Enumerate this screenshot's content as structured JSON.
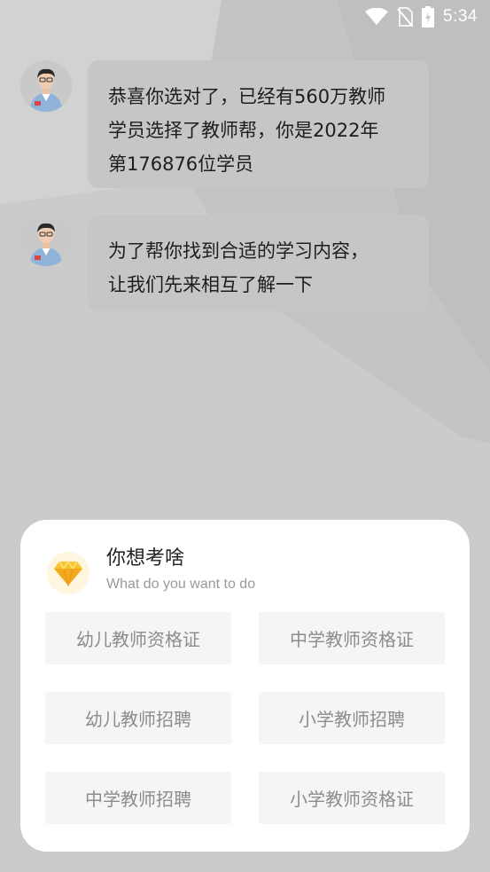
{
  "status_bar": {
    "time": "5:34",
    "icons": [
      "wifi-icon",
      "no-sim-icon",
      "battery-charging-icon"
    ]
  },
  "messages": [
    {
      "avatar": "teacher-avatar",
      "lines": [
        "恭喜你选对了，已经有560万教师",
        "学员选择了教师帮，你是2022年",
        "第176876位学员"
      ]
    },
    {
      "avatar": "teacher-avatar",
      "lines": [
        "为了帮你找到合适的学习内容，",
        "让我们先来相互了解一下"
      ]
    }
  ],
  "panel": {
    "icon": "diamond-icon",
    "title": "你想考啥",
    "subtitle": "What do you want to do",
    "options": [
      "幼儿教师资格证",
      "中学教师资格证",
      "幼儿教师招聘",
      "小学教师招聘",
      "中学教师招聘",
      "小学教师资格证"
    ]
  },
  "colors": {
    "background": "#cbcbcb",
    "bubble": "#c6c6c6",
    "panel": "#ffffff",
    "option_bg": "#f5f5f5",
    "option_text": "#8c8c8c",
    "gem": "#f5b820"
  }
}
